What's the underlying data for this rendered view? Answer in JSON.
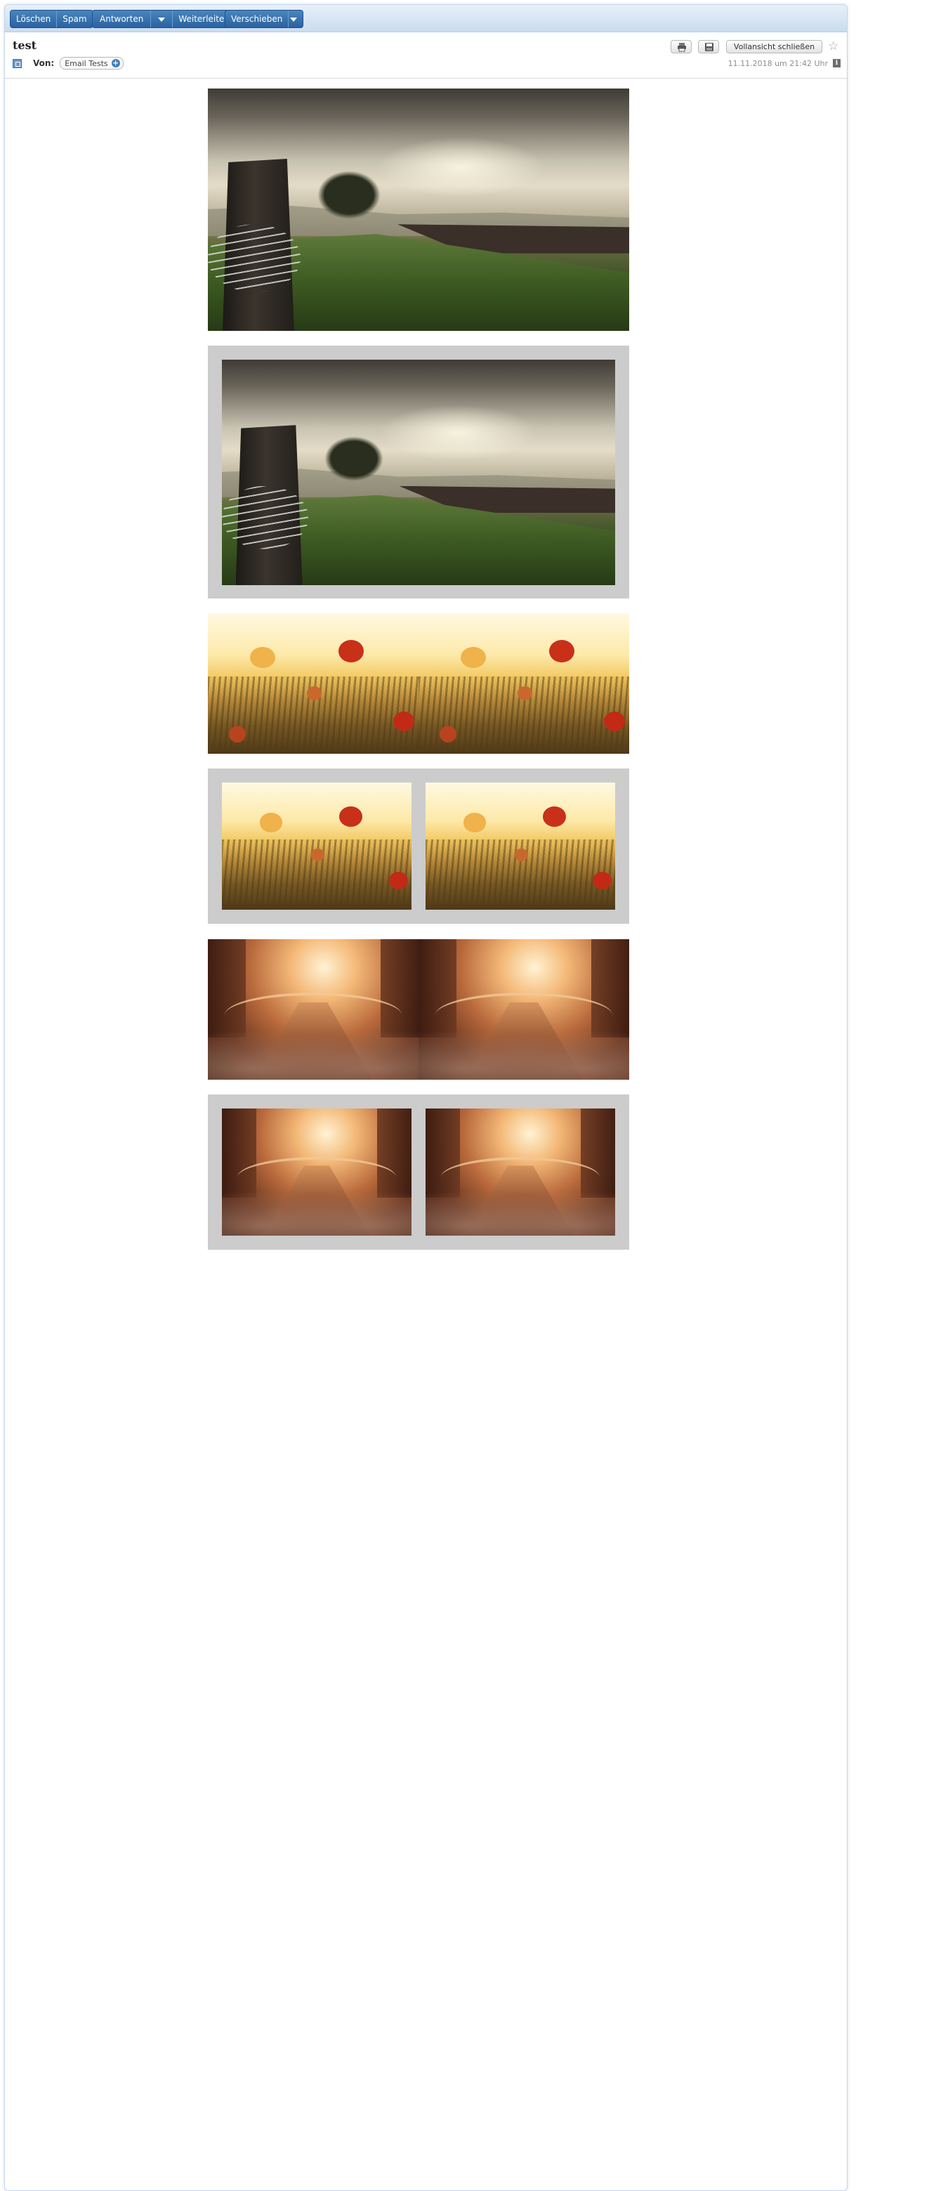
{
  "toolbar": {
    "delete": "Löschen",
    "spam": "Spam",
    "reply": "Antworten",
    "forward": "Weiterleiten",
    "move": "Verschieben"
  },
  "message": {
    "subject": "test",
    "from_label": "Von:",
    "sender": "Email Tests",
    "date": "11.11.2018 um 21:42 Uhr",
    "close_full_view": "Vollansicht schließen"
  },
  "icons": {
    "print": "print-icon",
    "save": "save-icon",
    "star": "star-icon",
    "info": "info-icon",
    "add_contact": "add-contact-icon"
  },
  "colors": {
    "toolbar_button": "#2a62a0",
    "gray_frame": "#cccccc",
    "frame_border": "#c4d7ea"
  }
}
